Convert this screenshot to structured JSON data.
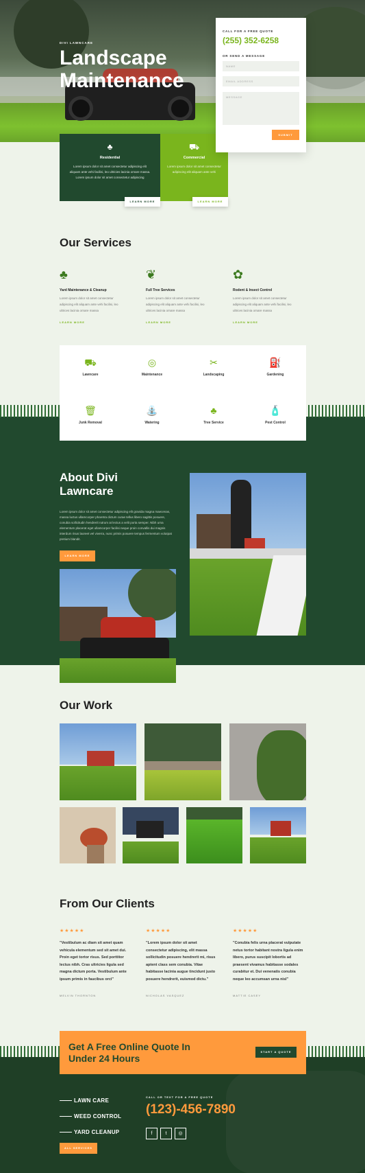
{
  "hero": {
    "eyebrow": "DIVI LAWNCARE",
    "title_line1": "Landscape",
    "title_line2": "Maintenance"
  },
  "quote_form": {
    "call_label": "CALL FOR A FREE QUOTE",
    "phone": "(255) 352-6258",
    "message_label": "OR SEND A MESSAGE",
    "name_placeholder": "NAME",
    "email_placeholder": "EMAIL ADDRESS",
    "message_placeholder": "MESSAGE",
    "submit_label": "SUBMIT"
  },
  "features": [
    {
      "title": "Residential",
      "text": "Lorem ipsum dolor sit amet consectetur adipiscing elit aliquam ante vehi facilisi, leo ultricies lacinia ornare massa. Lorem ipsum dolor sit amet consectetur adipiscing",
      "button": "LEARN MORE",
      "icon": "trees-icon"
    },
    {
      "title": "Commercial",
      "text": "Lorem ipsum dolor sit amet consectetur adipiscing elit aliquam ante vehi",
      "button": "LEARN MORE",
      "icon": "mower-icon"
    }
  ],
  "services": {
    "heading": "Our Services",
    "items": [
      {
        "title": "Yard Maintenance & Cleanup",
        "text": "Lorem ipsum dolor sit amet consectetur adipiscing elit aliquam ante vehi facilisi, leo ultrices lacinia ornare massa",
        "link": "LEARN MORE",
        "icon": "trees-icon"
      },
      {
        "title": "Full Tree Services",
        "text": "Lorem ipsum dolor sit amet consectetur adipiscing elit aliquam ante vehi facilisi, leo ultrices lacinia ornare massa",
        "link": "LEARN MORE",
        "icon": "sprout-icon"
      },
      {
        "title": "Rodent & Insect Control",
        "text": "Lorem ipsum dolor sit amet consectetur adipiscing elit aliquam ante vehi facilisi, leo ultrices lacinia ornare massa",
        "link": "LEARN MORE",
        "icon": "flower-icon"
      }
    ],
    "grid": [
      {
        "label": "Lawncare",
        "icon": "mower-icon"
      },
      {
        "label": "Maintenance",
        "icon": "hose-icon"
      },
      {
        "label": "Landscaping",
        "icon": "shears-icon"
      },
      {
        "label": "Gardening",
        "icon": "watering-can-icon"
      },
      {
        "label": "Junk Removal",
        "icon": "trash-icon"
      },
      {
        "label": "Watering",
        "icon": "sprinkler-icon"
      },
      {
        "label": "Tree Service",
        "icon": "trees-icon"
      },
      {
        "label": "Pest Control",
        "icon": "spray-icon"
      }
    ]
  },
  "about": {
    "title_line1": "About Divi",
    "title_line2": "Lawncare",
    "text": "Lorem ipsum dolor sit amet consectetur adipiscing elit gravida magna maecenas, massa luctus ullamcorper pharetra dictum curae tellus libero sagittis posuere, conubia sollicitudin hendrerit rutrum at lectus a velit porta semper. Nibh urna elementum placerat eget ullamcorper facilisi neque proin convallis dui magnis interdum risus laoreet vel viverra, nunc primis posuere tempus fermentum volutpat pretium blandit.",
    "button": "LEARN MORE"
  },
  "work": {
    "heading": "Our Work"
  },
  "clients": {
    "heading": "From Our Clients",
    "stars": "★★★★★",
    "items": [
      {
        "quote": "\"Vestibulum ac diam sit amet quam vehicula elementum sed sit amet dui. Proin eget tortor risus. Sed porttitor lectus nibh. Cras ultricies ligula sed magna dictum porta. Vestibulum ante ipsum primis in faucibus orci\"",
        "author": "MELVIN THORNTON"
      },
      {
        "quote": "\"Lorem ipsum dolor sit amet consectetur adipiscing, elit massa sollicitudin posuere hendrerit mi, risus aptent class sem conubia. Vitae habitasse lacinia augue tincidunt justo posuere hendrerit, euismod dictu.\"",
        "author": "NICHOLAS VASQUEZ"
      },
      {
        "quote": "\"Conubia felis urna placerat vulputate netus tortor habitant nostra ligula enim libero, purus suscipit lobortis ad praesent vivamus habitasse sodales curabitur et. Dui venenatis conubia neque leo accumsan urna nisl\"",
        "author": "MATTIE CASEY"
      }
    ]
  },
  "cta": {
    "title_line1": "Get A Free Online Quote In",
    "title_line2": "Under 24 Hours",
    "button": "START A QUOTE"
  },
  "footer": {
    "nav": [
      "LAWN CARE",
      "WEED CONTROL",
      "YARD CLEANUP"
    ],
    "services_button": "ALL SERVICES",
    "call_label": "CALL OR TEXT FOR A FREE QUOTE",
    "phone": "(123)-456-7890",
    "social": [
      {
        "icon": "facebook-icon",
        "glyph": "f"
      },
      {
        "icon": "twitter-icon",
        "glyph": "t"
      },
      {
        "icon": "instagram-icon",
        "glyph": "◎"
      }
    ]
  },
  "colors": {
    "accent_green": "#7ab51d",
    "dark_green": "#21492e",
    "orange": "#ff9a3c",
    "background": "#eef3ea"
  }
}
